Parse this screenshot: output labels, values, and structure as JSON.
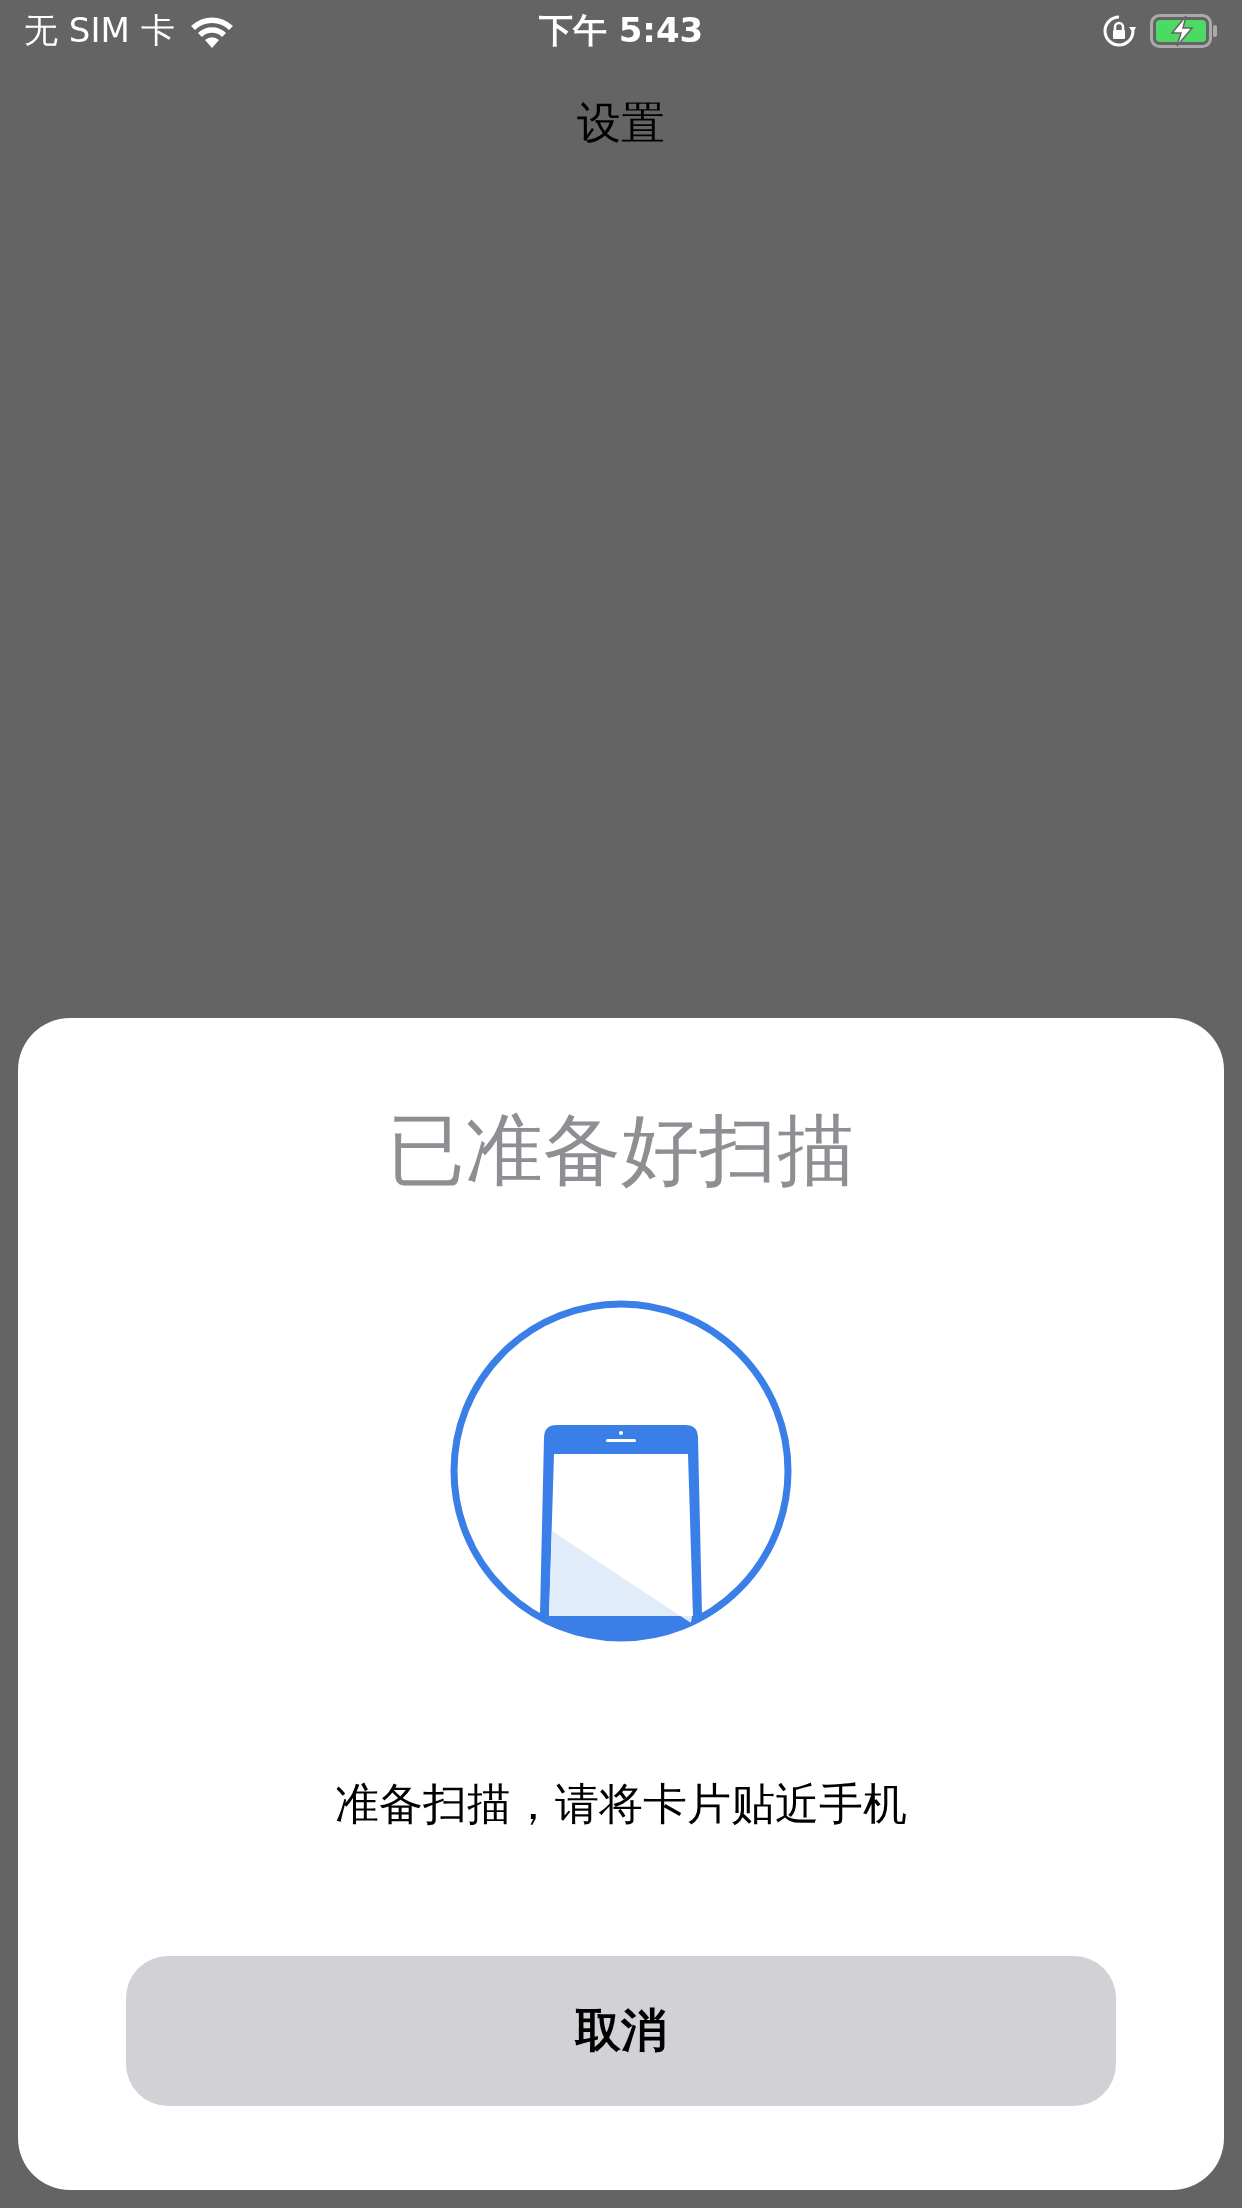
{
  "status_bar": {
    "carrier": "无 SIM 卡",
    "time": "下午 5:43",
    "charging": true
  },
  "nav": {
    "title": "设置"
  },
  "sheet": {
    "title": "已准备好扫描",
    "message": "准备扫描，请将卡片贴近手机",
    "cancel_button": "取消"
  }
}
